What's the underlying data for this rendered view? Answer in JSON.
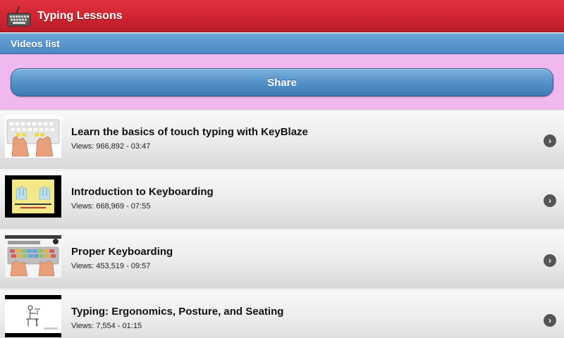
{
  "app": {
    "title": "Typing Lessons",
    "icon": "keyboard-icon"
  },
  "section": {
    "title": "Videos list"
  },
  "share": {
    "label": "Share"
  },
  "videos": [
    {
      "title": "Learn the basics of touch typing with KeyBlaze",
      "meta": "Views: 966,892 - 03:47"
    },
    {
      "title": "Introduction to Keyboarding",
      "meta": "Views: 668,969 - 07:55"
    },
    {
      "title": "Proper Keyboarding",
      "meta": "Views: 453,519 - 09:57"
    },
    {
      "title": "Typing: Ergonomics, Posture, and Seating",
      "meta": "Views: 7,554 - 01:15"
    }
  ],
  "colors": {
    "titlebar": "#d02431",
    "sectionbar": "#4b87c3",
    "share_area": "#f0b8ee",
    "share_button": "#5591c9"
  }
}
